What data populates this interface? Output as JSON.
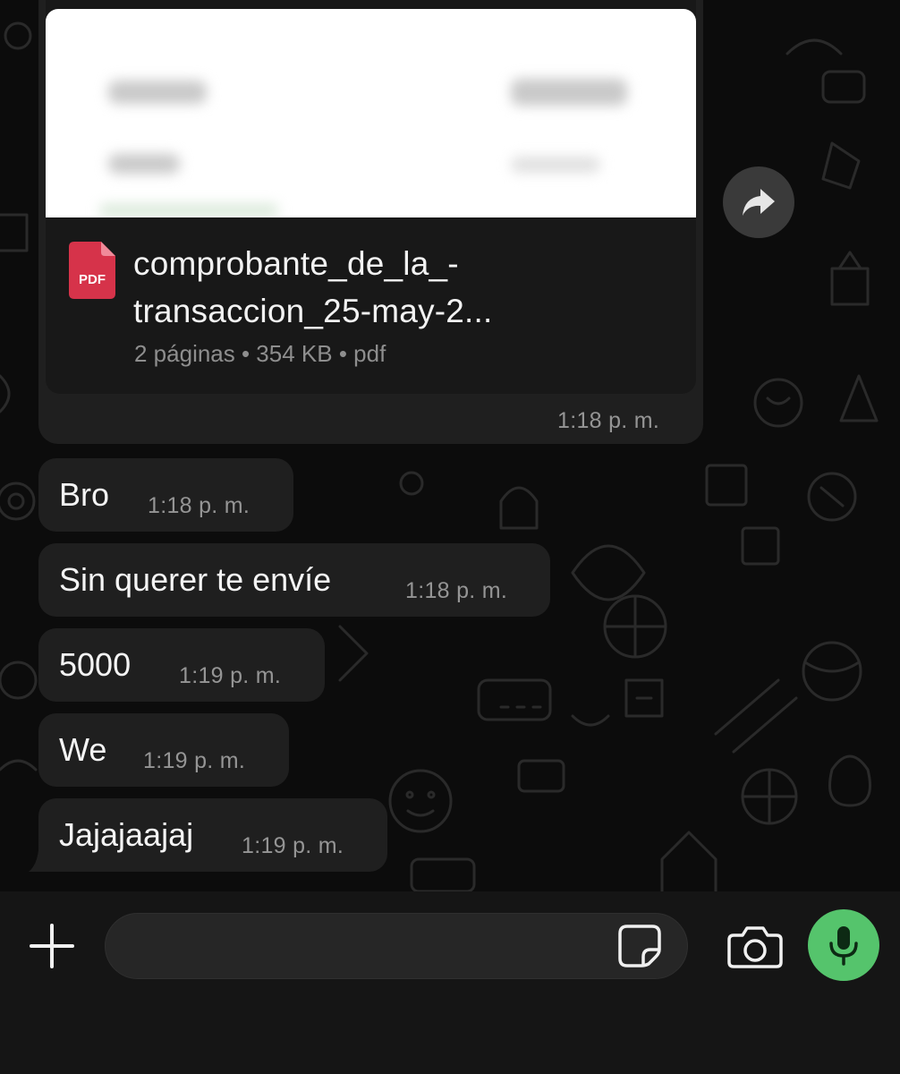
{
  "document_message": {
    "file_name_line1": "comprobante_de_la_-",
    "file_name_line2": "transaccion_25-may-2...",
    "file_icon_label": "PDF",
    "meta": "2 páginas • 354 KB • pdf",
    "time": "1:18 p. m."
  },
  "messages": [
    {
      "text": "Bro",
      "time": "1:18 p. m."
    },
    {
      "text": "Sin querer te envíe",
      "time": "1:18 p. m."
    },
    {
      "text": "5000",
      "time": "1:19 p. m."
    },
    {
      "text": "We",
      "time": "1:19 p. m."
    },
    {
      "text": "Jajajaajaj",
      "time": "1:19 p. m."
    }
  ],
  "composer": {
    "placeholder": ""
  },
  "colors": {
    "bubble": "#1f1f1f",
    "mic_button": "#55c46c",
    "pdf_icon": "#d6334a",
    "timestamp": "#959595"
  },
  "icons": [
    "forward-icon",
    "pdf-file-icon",
    "plus-icon",
    "sticker-icon",
    "camera-icon",
    "microphone-icon"
  ]
}
